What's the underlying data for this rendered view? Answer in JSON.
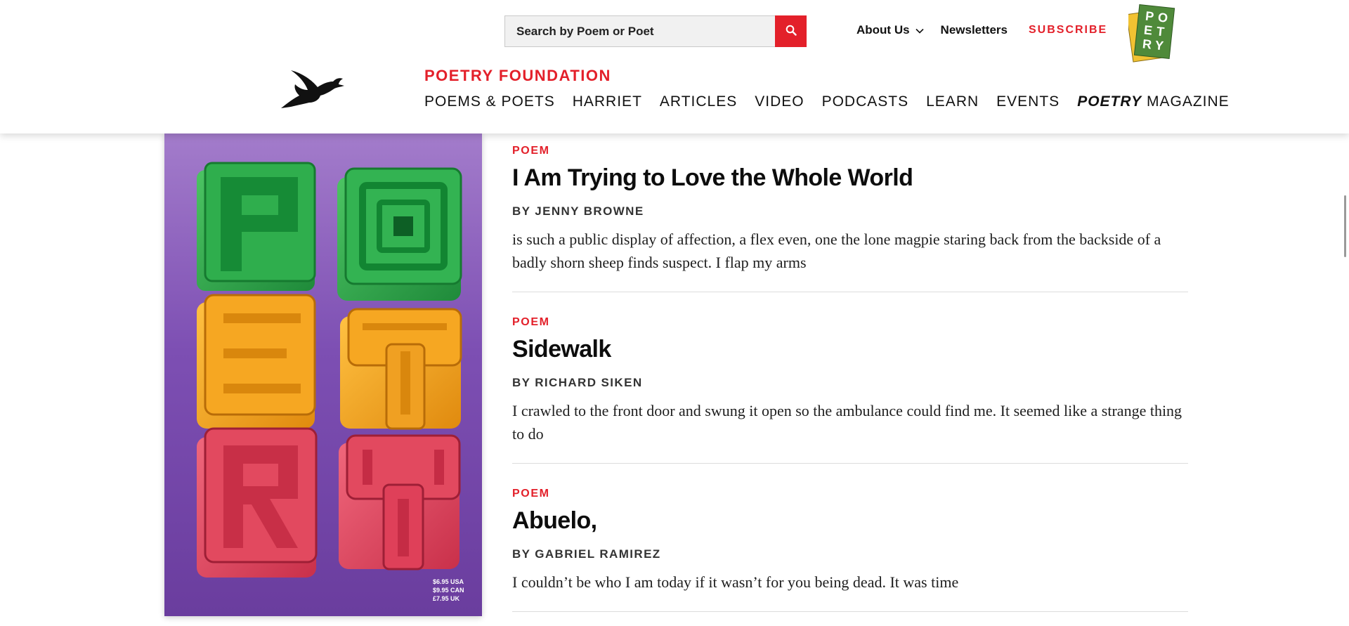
{
  "header": {
    "search": {
      "placeholder": "Search by Poem or Poet",
      "value": ""
    },
    "utility_nav": {
      "about": "About Us",
      "newsletters": "Newsletters",
      "subscribe": "SUBSCRIBE"
    },
    "brand": "POETRY FOUNDATION",
    "main_nav": [
      "POEMS & POETS",
      "HARRIET",
      "ARTICLES",
      "VIDEO",
      "PODCASTS",
      "LEARN",
      "EVENTS"
    ],
    "magazine_nav": {
      "italic": "POETRY",
      "rest": " MAGAZINE"
    },
    "badge_letters": [
      "P",
      "O",
      "E",
      "T",
      "R",
      "Y"
    ]
  },
  "cover": {
    "prices": [
      "$6.95 USA",
      "$9.95 CAN",
      "£7.95 UK"
    ]
  },
  "articles": [
    {
      "tag": "POEM",
      "title": "I Am Trying to Love the Whole World",
      "byline": "BY JENNY BROWNE",
      "excerpt": "is such a public display of affection, a flex even, one the lone magpie staring back from the backside of a badly shorn sheep finds suspect. I flap my arms"
    },
    {
      "tag": "POEM",
      "title": "Sidewalk",
      "byline": "BY RICHARD SIKEN",
      "excerpt": "I crawled to the front door and swung it open so the ambulance could find me. It seemed like a strange thing to do"
    },
    {
      "tag": "POEM",
      "title": "Abuelo,",
      "byline": "BY GABRIEL RAMIREZ",
      "excerpt": "I couldn’t be who I am today if it wasn’t for you being dead. It was time"
    }
  ],
  "colors": {
    "brand_red": "#e3202a",
    "cover_purple": "#7d4fb3",
    "cover_green": "#2aa84a",
    "cover_orange": "#f2a21b",
    "cover_pink": "#e0455e"
  },
  "icons": [
    "search-icon",
    "chevron-down-icon",
    "pegasus-logo-icon"
  ]
}
